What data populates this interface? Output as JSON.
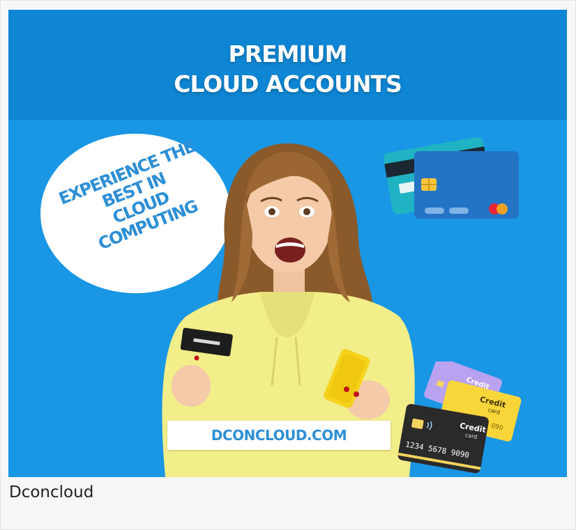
{
  "banner": {
    "title_line1": "PREMIUM",
    "title_line2": "CLOUD ACCOUNTS",
    "bubble_lines": [
      "EXPERIENCE THE",
      "BEST IN",
      "CLOUD",
      "COMPUTING"
    ],
    "url": "DCONCLOUD.COM",
    "cards": {
      "front_label": "Credit",
      "front_sublabel": "card",
      "front_number": "1234 5678 9090"
    }
  },
  "caption": "Dconcloud",
  "colors": {
    "background_blue": "#1996e4",
    "header_blue": "#0e86d4",
    "text_blue": "#2d8fd6",
    "sweater_yellow": "#f2ee8a"
  },
  "icons": [
    "chip-icon",
    "contactless-icon",
    "mastercard-icon",
    "smartphone-icon"
  ]
}
